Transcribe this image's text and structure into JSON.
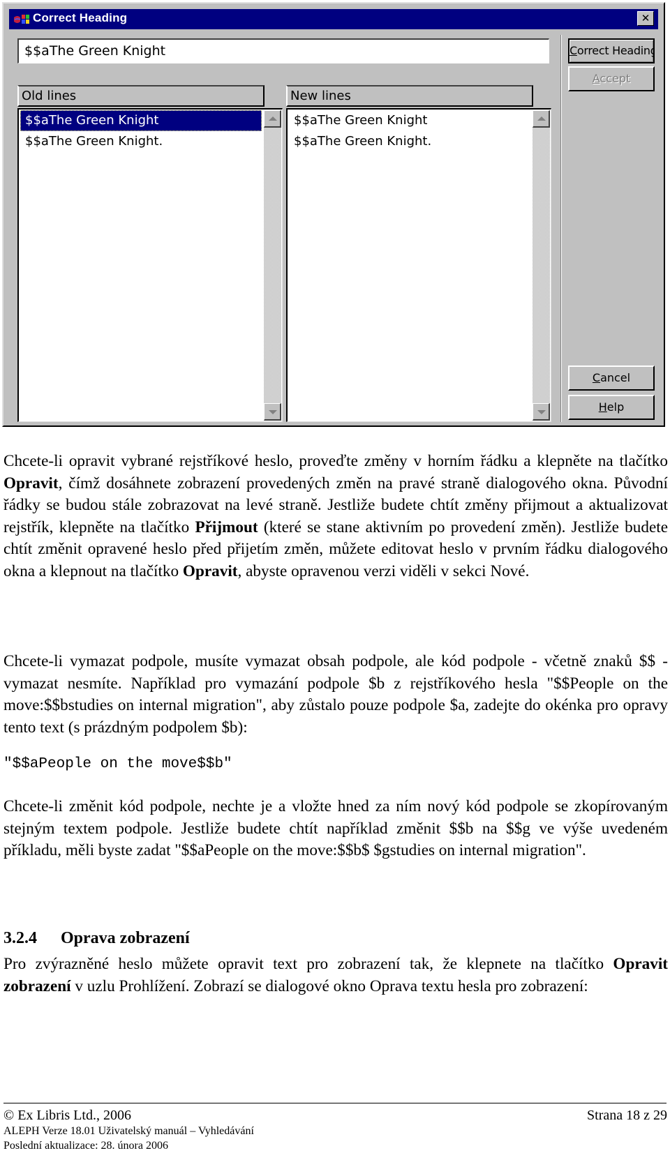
{
  "dialog": {
    "title": "Correct Heading",
    "close_label": "✕",
    "heading_input_value": "$$aThe Green Knight",
    "old_lines": {
      "header": "Old lines",
      "items": [
        "$$aThe Green Knight",
        "$$aThe Green Knight."
      ],
      "selected_index": 0
    },
    "new_lines": {
      "header": "New lines",
      "items": [
        "$$aThe Green Knight",
        "$$aThe Green Knight."
      ]
    },
    "buttons": {
      "correct_heading": {
        "mnemonic": "C",
        "rest": "orrect Heading",
        "enabled": true
      },
      "accept": {
        "mnemonic": "A",
        "rest": "ccept",
        "enabled": false
      },
      "cancel": {
        "mnemonic": "C",
        "rest": "ancel",
        "enabled": true
      },
      "help": {
        "mnemonic": "H",
        "rest": "elp",
        "enabled": true
      }
    },
    "colors": {
      "titlebar": "#000080",
      "face": "#c0c0c0",
      "selection": "#000080"
    }
  },
  "document": {
    "paragraph1": {
      "t1": "Chcete-li opravit vybrané rejstříkové heslo, proveďte změny v horním řádku a klepněte na tlačítko ",
      "b1": "Opravit",
      "t2": ", čímž dosáhnete zobrazení provedených změn na pravé straně dialogového okna. Původní řádky se budou stále zobrazovat na levé straně. Jestliže budete chtít změny přijmout a aktualizovat rejstřík, klepněte na tlačítko ",
      "b2": "Přijmout",
      "t3": " (které se stane aktivním po provedení změn). Jestliže budete chtít změnit opravené heslo před přijetím změn, můžete editovat heslo v prvním řádku dialogového okna a klepnout na tlačítko ",
      "b3": "Opravit",
      "t4": ", abyste opravenou verzi viděli v sekci Nové."
    },
    "paragraph2": "Chcete-li vymazat podpole, musíte vymazat obsah podpole, ale kód podpole - včetně znaků $$ - vymazat nesmíte. Například pro vymazání podpole $b z rejstříkového hesla \"$$People on the move:$$bstudies on internal migration\", aby zůstalo pouze podpole $a, zadejte do okénka pro opravy tento text (s prázdným podpolem $b):",
    "code_example": "\"$$aPeople on the move$$b\"",
    "paragraph3": "Chcete-li změnit kód podpole, nechte je a vložte hned za ním nový kód podpole se zkopírovaným stejným textem podpole. Jestliže budete chtít například změnit $$b na $$g ve výše uvedeném příkladu, měli byste zadat \"$$aPeople on the move:$$b$ $gstudies on internal migration\".",
    "section": {
      "number": "3.2.4",
      "title": "Oprava zobrazení"
    },
    "paragraph4": {
      "t1": "Pro zvýrazněné heslo můžete opravit text pro zobrazení tak, že klepnete na tlačítko ",
      "b1": "Opravit zobrazení",
      "t2": " v uzlu Prohlížení. Zobrazí se dialogové okno Oprava textu hesla pro zobrazení:"
    }
  },
  "footer": {
    "copyright": "© Ex Libris Ltd., 2006",
    "page": "Strana 18 z 29",
    "manual": "ALEPH Verze 18.01 Uživatelský manuál – Vyhledávání",
    "updated": "Poslední aktualizace: 28. února 2006"
  }
}
